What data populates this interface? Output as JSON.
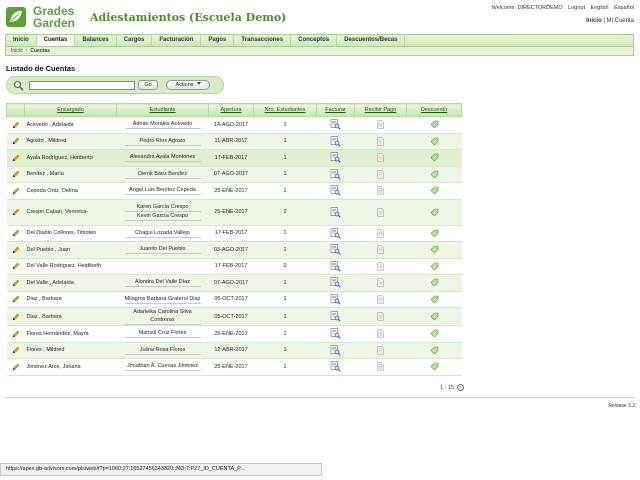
{
  "header": {
    "logo_line1": "Grades",
    "logo_line2": "Garden",
    "title": "Adiestamientos (Escuela Demo)",
    "top_links": [
      "Welcome: DIRECTORDEMO",
      "Logout",
      "English",
      "Español"
    ],
    "user_links": {
      "home": "Inicio",
      "separator": "|",
      "account": "Mi Cuenta"
    }
  },
  "tabs": [
    "Inicio",
    "Cuentas",
    "Balances",
    "Cargos",
    "Facturación",
    "Pagos",
    "Transacciones",
    "Conceptos",
    "Descuentos/Becas"
  ],
  "active_tab": "Cuentas",
  "breadcrumb": {
    "home": "Inicio",
    "sep": "›",
    "current": "Cuentas"
  },
  "section_title": "Listado de Cuentas",
  "search": {
    "value": "",
    "go_label": "Go",
    "actions_label": "Actions"
  },
  "table": {
    "headers": [
      "Encargado",
      "Estudiante",
      "Apertura",
      "Nro. Estudiantes",
      "Facturar",
      "Recibir Pago",
      "Descuento"
    ],
    "rows": [
      {
        "encargado": "Acevedo , Adelaida",
        "estudiantes": [
          "Adrián Morales Acevedo"
        ],
        "apertura": "14-AGO-2017",
        "nro": "1"
      },
      {
        "encargado": "Agosto , Mildred",
        "estudiantes": [
          "Pedro Ríos Agosto"
        ],
        "apertura": "11-ABR-2017",
        "nro": "1"
      },
      {
        "encargado": "Ayala Rodríguez, Heriberto",
        "estudiantes": [
          "Alexandra Ayala Montones"
        ],
        "apertura": "17-FEB-2017",
        "nro": "1"
      },
      {
        "encargado": "Benítez , María",
        "estudiantes": [
          "Derrik Báez Benítez"
        ],
        "apertura": "07-AGO-2017",
        "nro": "1"
      },
      {
        "encargado": "Cepeda Ortiz, Delma",
        "estudiantes": [
          "Angel Luis Benítez Cepeda"
        ],
        "apertura": "25-ENE-2017",
        "nro": "1"
      },
      {
        "encargado": "Crespo Caban, Veronica-",
        "estudiantes": [
          "Karen García Crespo",
          "Kevin García Crespo"
        ],
        "apertura": "25-ENE-2017",
        "nro": "2"
      },
      {
        "encargado": "Del Diablo Collores, Timoteo",
        "estudiantes": [
          "Chagui Lozada Vallejo"
        ],
        "apertura": "17-FEB-2017",
        "nro": "1"
      },
      {
        "encargado": "Del Pueblo , Juan",
        "estudiantes": [
          "Juanito Del Pueblo"
        ],
        "apertura": "03-AGO-2017",
        "nro": "1"
      },
      {
        "encargado": "Del Valle Rodriguez, Heidibeth",
        "estudiantes": [],
        "apertura": "17-FEB-2017",
        "nro": "0"
      },
      {
        "encargado": "Del Valle , Adelaida",
        "estudiantes": [
          "Alondra Del Valle Díaz"
        ],
        "apertura": "07-AGO-2017",
        "nro": "1"
      },
      {
        "encargado": "Diaz , Barbara",
        "estudiantes": [
          "Milagros Barbara Graterol Diaz"
        ],
        "apertura": "05-OCT-2017",
        "nro": "1"
      },
      {
        "encargado": "Diaz , Barbara",
        "estudiantes": [
          "Adarleika Carolina Silva Contreras"
        ],
        "apertura": "05-OCT-2017",
        "nro": "1"
      },
      {
        "encargado": "Flores Hernández, Mayra",
        "estudiantes": [
          "Marisol Cruz Flores"
        ],
        "apertura": "25-ENE-2017",
        "nro": "1"
      },
      {
        "encargado": "Flores , Mildred",
        "estudiantes": [
          "Julina Rosa Flores"
        ],
        "apertura": "12-ABR-2017",
        "nro": "1"
      },
      {
        "encargado": "Jiménez Arce, Johana",
        "estudiantes": [
          "Jonathan A. Cuevas Jiménez"
        ],
        "apertura": "25-ENE-2017",
        "nro": "1"
      }
    ]
  },
  "pagination": "1 - 15",
  "release": "Release 3.2",
  "status_url": "https://apex.gb-advisors.com/pls/web/f?p=1060:27:16527456343320::NO:7:P27_ID_CUENTA_P...",
  "colors": {
    "brand_green": "#5aa13a",
    "tab_bg": "#cfe9b7",
    "row_alt": "#eef7e6"
  },
  "icons": {
    "edit": "pencil-icon",
    "invoice": "invoice-magnifier-icon",
    "payment": "receipt-icon",
    "discount": "discount-tag-icon",
    "search": "magnifier-icon"
  }
}
